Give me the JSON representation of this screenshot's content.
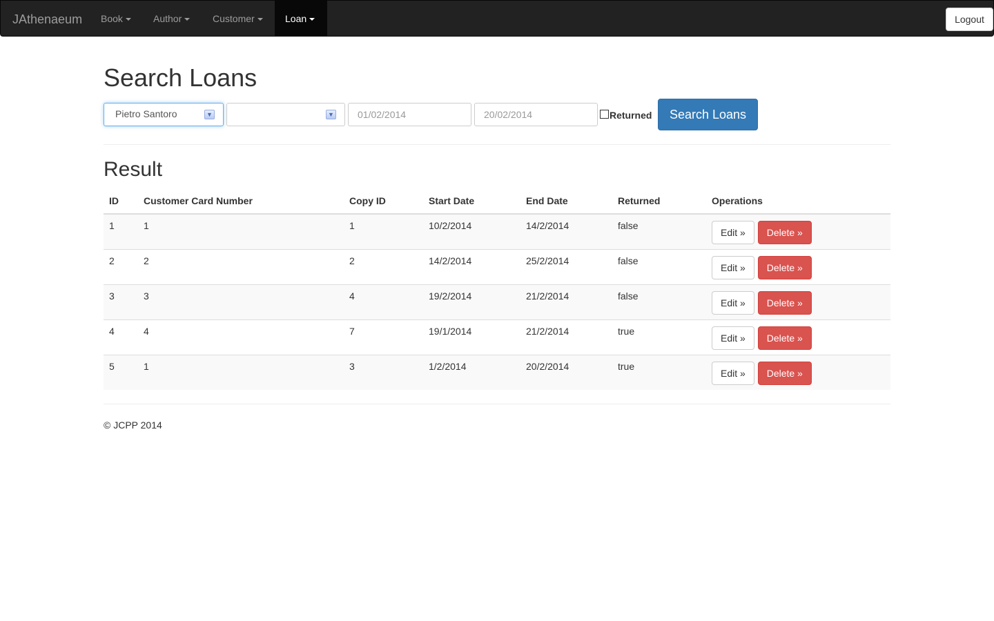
{
  "navbar": {
    "brand": "JAthenaeum",
    "items": [
      {
        "label": "Book",
        "active": false
      },
      {
        "label": "Author",
        "active": false
      },
      {
        "label": "Customer",
        "active": false
      },
      {
        "label": "Loan",
        "active": true
      }
    ],
    "logout": "Logout"
  },
  "search": {
    "title": "Search Loans",
    "customer_select": "Pietro Santoro",
    "copy_select": "",
    "start_date_placeholder": "01/02/2014",
    "end_date_placeholder": "20/02/2014",
    "returned_label": "Returned",
    "returned_checked": false,
    "button": "Search Loans"
  },
  "result": {
    "title": "Result",
    "columns": [
      "ID",
      "Customer Card Number",
      "Copy ID",
      "Start Date",
      "End Date",
      "Returned",
      "Operations"
    ],
    "rows": [
      {
        "id": "1",
        "card": "1",
        "copy": "1",
        "start": "10/2/2014",
        "end": "14/2/2014",
        "returned": "false"
      },
      {
        "id": "2",
        "card": "2",
        "copy": "2",
        "start": "14/2/2014",
        "end": "25/2/2014",
        "returned": "false"
      },
      {
        "id": "3",
        "card": "3",
        "copy": "4",
        "start": "19/2/2014",
        "end": "21/2/2014",
        "returned": "false"
      },
      {
        "id": "4",
        "card": "4",
        "copy": "7",
        "start": "19/1/2014",
        "end": "21/2/2014",
        "returned": "true"
      },
      {
        "id": "5",
        "card": "1",
        "copy": "3",
        "start": "1/2/2014",
        "end": "20/2/2014",
        "returned": "true"
      }
    ],
    "edit_label": "Edit »",
    "delete_label": "Delete »"
  },
  "footer": "© JCPP 2014",
  "colors": {
    "primary": "#337ab7",
    "danger": "#d9534f",
    "navbar": "#222222"
  }
}
